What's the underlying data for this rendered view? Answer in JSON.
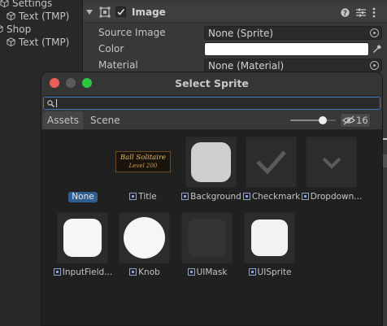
{
  "hierarchy": {
    "items": [
      {
        "label": "Settings",
        "indent": 1
      },
      {
        "label": "Text (TMP)",
        "indent": 2
      },
      {
        "label": "Shop",
        "indent": 1
      },
      {
        "label": "Text (TMP)",
        "indent": 2
      }
    ]
  },
  "inspector": {
    "component_title": "Image",
    "component_enabled": true,
    "properties": [
      {
        "label": "Source Image",
        "value": "None (Sprite)"
      },
      {
        "label": "Color",
        "value": ""
      },
      {
        "label": "Material",
        "value": "None (Material)"
      }
    ]
  },
  "dialog": {
    "title": "Select Sprite",
    "search_value": "",
    "tabs": [
      "Assets",
      "Scene"
    ],
    "active_tab": "Assets",
    "visible_count": "16",
    "zoom_level": 0.75,
    "assets": [
      {
        "label": "None",
        "kind": "none",
        "selected": true
      },
      {
        "label": "Title",
        "kind": "title",
        "image_text_line1": "Ball Solitaire",
        "image_text_line2": "Level 200"
      },
      {
        "label": "Background",
        "kind": "rounded-light"
      },
      {
        "label": "Checkmark",
        "kind": "check"
      },
      {
        "label": "Dropdown...",
        "kind": "chevron"
      },
      {
        "label": "InputField...",
        "kind": "rounded-white"
      },
      {
        "label": "Knob",
        "kind": "circle"
      },
      {
        "label": "UIMask",
        "kind": "rounded-dark"
      },
      {
        "label": "UISprite",
        "kind": "rounded-white2"
      }
    ]
  },
  "colors": {
    "accent": "#3a79bb",
    "selected_label_bg": "#2f5e93",
    "close_dot": "#ec5f57",
    "min_dot": "#5b5b5b",
    "zoom_dot": "#2cc840"
  }
}
